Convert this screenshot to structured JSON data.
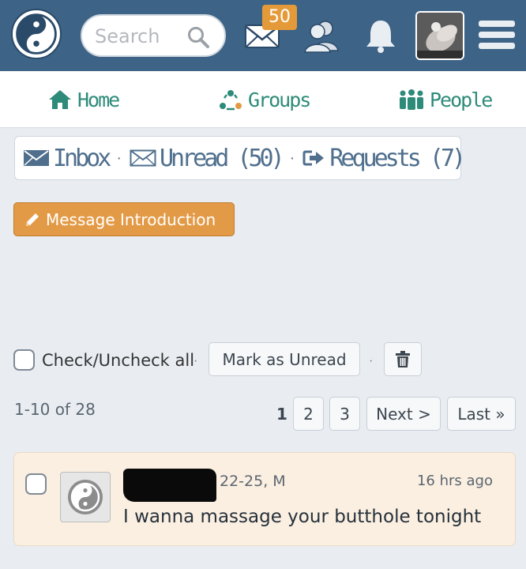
{
  "header": {
    "search_placeholder": "Search",
    "mail_badge": "50",
    "colors": {
      "bar": "#3d6387",
      "badge": "#e59a3a"
    },
    "icons": [
      "yin-yang-logo-icon",
      "search-icon",
      "mail-icon",
      "people-icon",
      "bell-icon",
      "menu-icon"
    ]
  },
  "nav": {
    "home": "Home",
    "groups": "Groups",
    "people": "People",
    "color": "#2e8b79"
  },
  "mailbox": {
    "inbox": "Inbox",
    "unread": "Unread (50)",
    "requests": "Requests (7)",
    "separator": "·",
    "color": "#4f6f8d"
  },
  "intro_button": {
    "label": "Message Introduction",
    "color": "#e39a46"
  },
  "actions": {
    "check_all": "Check/Uncheck all",
    "mark_unread": "Mark as Unread"
  },
  "pagination": {
    "range": "1-10 of 28",
    "current": "1",
    "pages": [
      "2",
      "3"
    ],
    "next": "Next >",
    "last": "Last »"
  },
  "messages": [
    {
      "meta": "22-25, M",
      "time": "16 hrs ago",
      "text": "I wanna massage your butthole tonight",
      "background": "#fbefe1"
    }
  ]
}
